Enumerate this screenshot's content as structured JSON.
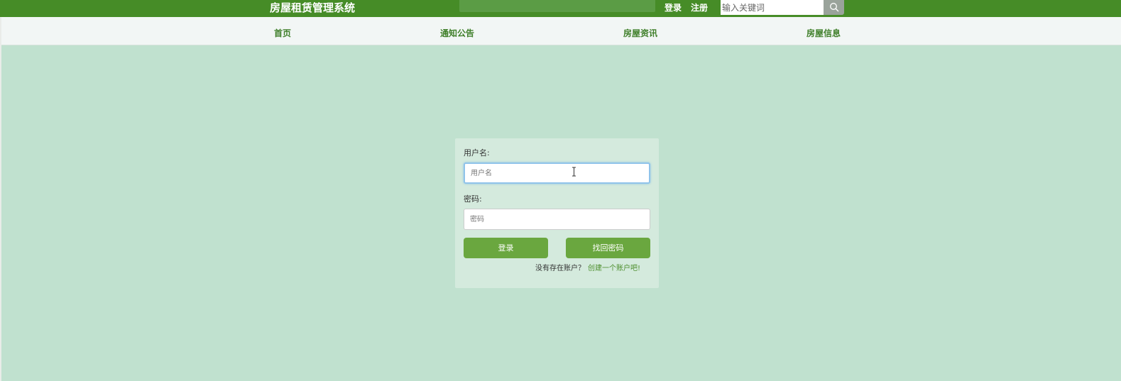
{
  "header": {
    "site_title": "房屋租赁管理系统",
    "login_link": "登录",
    "register_link": "注册",
    "search_placeholder": "输入关键词",
    "search_icon": "search-icon"
  },
  "nav": {
    "items": [
      {
        "label": "首页"
      },
      {
        "label": "通知公告"
      },
      {
        "label": "房屋资讯"
      },
      {
        "label": "房屋信息"
      }
    ]
  },
  "login": {
    "username_label": "用户名:",
    "username_placeholder": "用户名",
    "username_value": "",
    "password_label": "密码:",
    "password_placeholder": "密码",
    "password_value": "",
    "login_button": "登录",
    "forgot_button": "找回密码",
    "no_account_text": "没有存在账户？",
    "create_account_link": "创建一个账户吧!"
  },
  "colors": {
    "header_green": "#468c27",
    "nav_text": "#3f7f2a",
    "page_background": "#c0e1cf",
    "card_background": "#d4eadd",
    "button_green": "#6aa73f",
    "link_green": "#4e8f2e"
  }
}
